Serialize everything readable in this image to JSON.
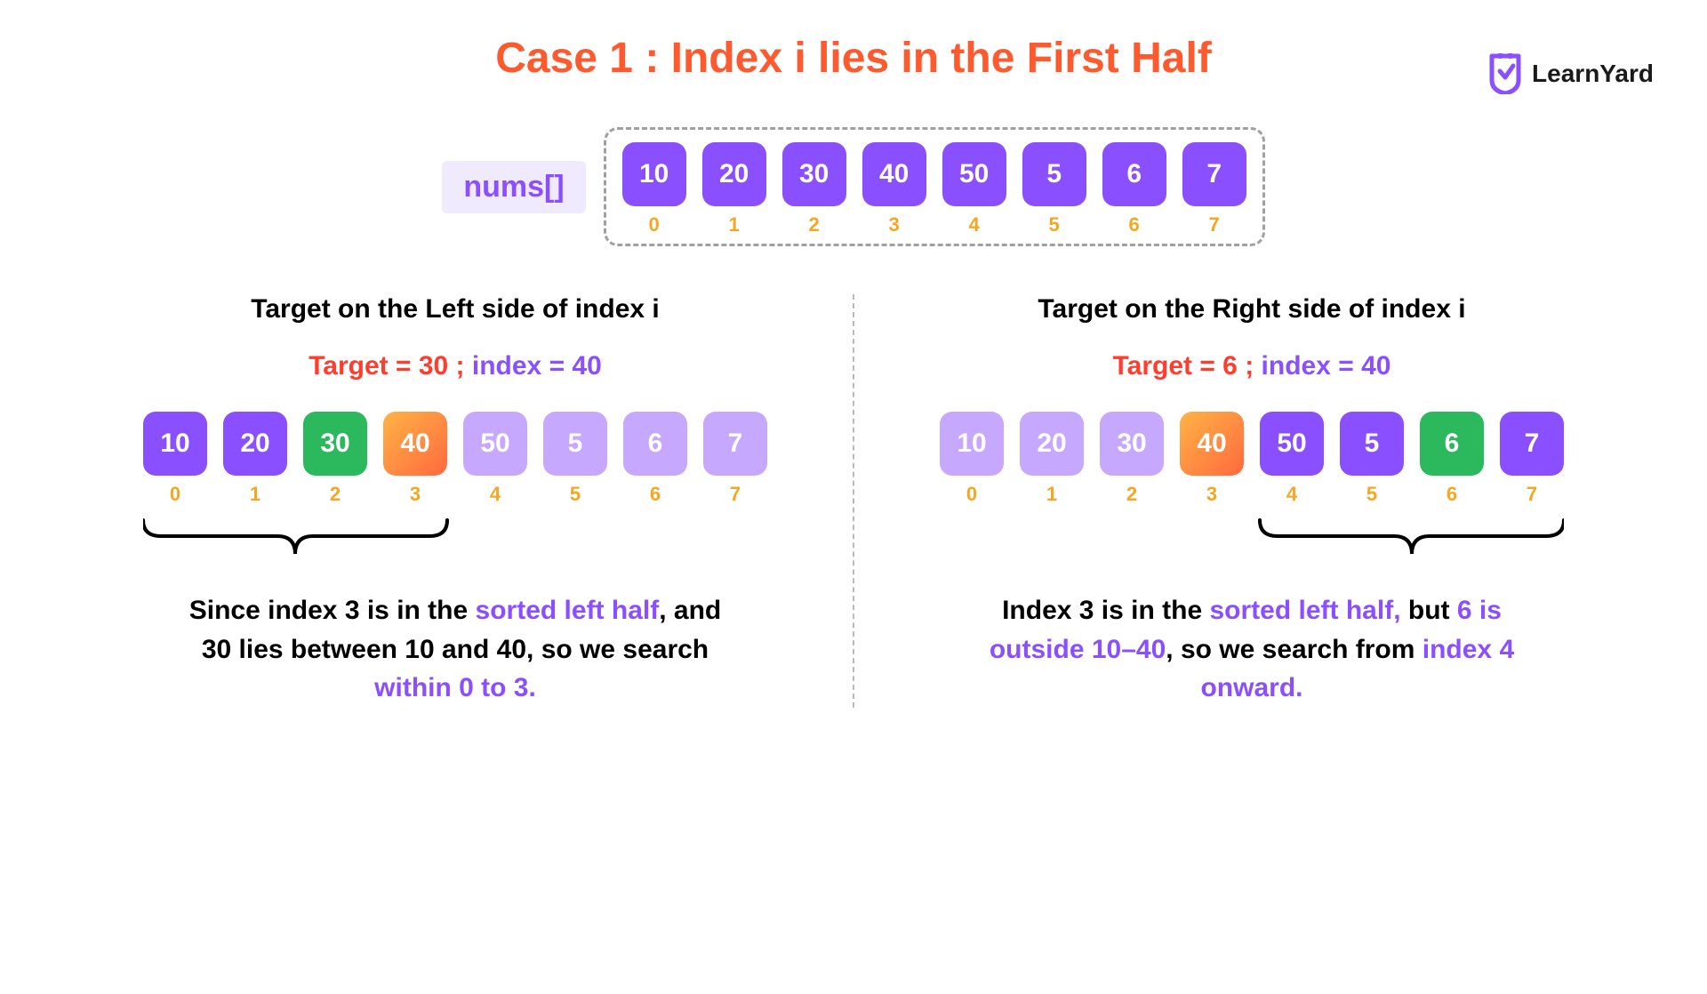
{
  "brand": "LearnYard",
  "title": "Case 1 : Index i lies in the First Half",
  "nums_label": "nums[]",
  "top_array": {
    "values": [
      "10",
      "20",
      "30",
      "40",
      "50",
      "5",
      "6",
      "7"
    ],
    "indices": [
      "0",
      "1",
      "2",
      "3",
      "4",
      "5",
      "6",
      "7"
    ]
  },
  "left": {
    "heading": "Target on the Left side of index i",
    "target_label": "Target = 30 ; ",
    "index_label": "index = 40",
    "values": [
      "10",
      "20",
      "30",
      "40",
      "50",
      "5",
      "6",
      "7"
    ],
    "indices": [
      "0",
      "1",
      "2",
      "3",
      "4",
      "5",
      "6",
      "7"
    ],
    "styles": [
      "dark",
      "dark",
      "green",
      "orange",
      "light",
      "light",
      "light",
      "light"
    ],
    "explain_before": "Since index 3 is in the ",
    "explain_hl1": "sorted left half",
    "explain_mid": ", and 30 lies between 10 and 40, so we search ",
    "explain_hl2": "within 0 to 3.",
    "brace_start": 0,
    "brace_end": 3
  },
  "right": {
    "heading": "Target on the Right side of index i",
    "target_label": "Target = 6 ; ",
    "index_label": "index = 40",
    "values": [
      "10",
      "20",
      "30",
      "40",
      "50",
      "5",
      "6",
      "7"
    ],
    "indices": [
      "0",
      "1",
      "2",
      "3",
      "4",
      "5",
      "6",
      "7"
    ],
    "styles": [
      "light",
      "light",
      "light",
      "orange",
      "dark",
      "dark",
      "green",
      "dark"
    ],
    "explain_before": "Index 3 is in the ",
    "explain_hl1": "sorted left half,",
    "explain_mid": " but ",
    "explain_hl2": "6 is outside 10–40",
    "explain_mid2": ", so we search from ",
    "explain_hl3": "index 4 onward.",
    "brace_start": 4,
    "brace_end": 7
  }
}
